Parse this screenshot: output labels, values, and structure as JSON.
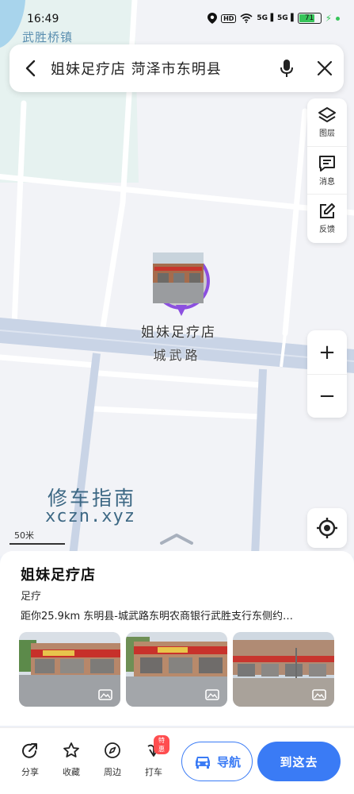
{
  "status_bar": {
    "time": "16:49",
    "hd_label": "HD",
    "signal_1": "5G",
    "signal_2": "5G",
    "battery": "71",
    "battery_level": 0.71
  },
  "search": {
    "query": "姐妹足疗店 菏泽市东明县"
  },
  "map": {
    "place_label": "武胜桥镇",
    "poi_name": "姐妹足疗店",
    "road_name": "城武路",
    "watermark_cn": "修车指南",
    "watermark_url": "xczn.xyz",
    "scale": "50米"
  },
  "tools": {
    "layers": "图层",
    "messages": "消息",
    "feedback": "反馈",
    "zoom_in": "+",
    "zoom_out": "−"
  },
  "poi": {
    "title": "姐妹足疗店",
    "category": "足疗",
    "distance_address": "距你25.9km  东明县-城武路东明农商银行武胜支行东侧约…",
    "photos": [
      "photo-1",
      "photo-2",
      "photo-3"
    ]
  },
  "actions": {
    "share": "分享",
    "favorite": "收藏",
    "nearby": "周边",
    "taxi": "打车",
    "taxi_badge": "特惠",
    "navigate": "导航",
    "go_here": "到这去"
  },
  "colors": {
    "accent": "#3a7bf5",
    "marker": "#8c4fe0",
    "water": "#d8eef1"
  }
}
